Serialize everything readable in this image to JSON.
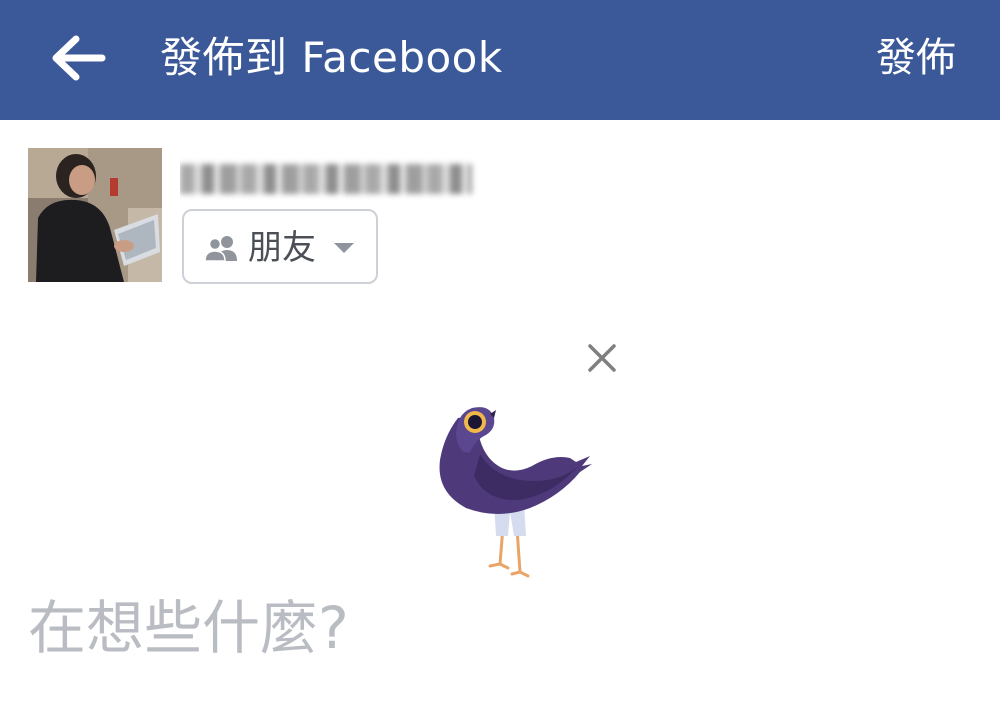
{
  "topbar": {
    "back_icon": "arrow-left-icon",
    "title": "發佈到 Facebook",
    "post_label": "發佈",
    "background_color": "#3b5998",
    "text_color": "#ffffff"
  },
  "composer": {
    "avatar_icon": "user-photo",
    "username": "",
    "audience": {
      "icon": "friends-icon",
      "label": "朋友",
      "dropdown_icon": "caret-down-icon"
    }
  },
  "sticker": {
    "close_icon": "close-icon",
    "image": "purple-pigeon-sticker"
  },
  "status_input": {
    "placeholder": "在想些什麼?"
  }
}
